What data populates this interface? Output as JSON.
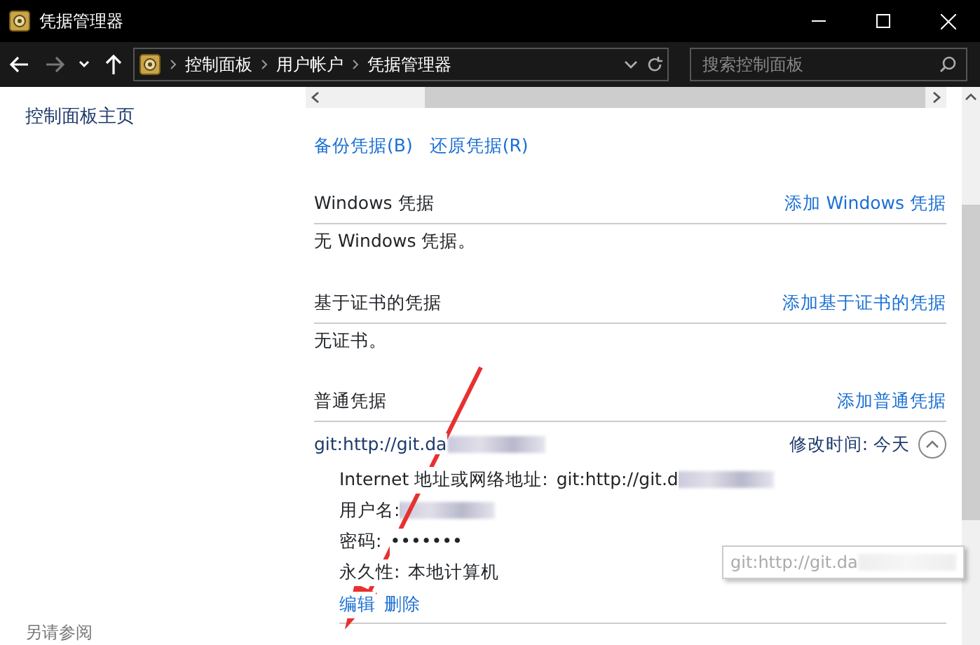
{
  "window": {
    "title": "凭据管理器"
  },
  "address_bar": {
    "breadcrumbs": [
      "控制面板",
      "用户帐户",
      "凭据管理器"
    ]
  },
  "search": {
    "placeholder": "搜索控制面板"
  },
  "sidebar": {
    "home_link": "控制面板主页",
    "see_also": "另请参阅"
  },
  "actions": [
    "备份凭据(B)",
    "还原凭据(R)"
  ],
  "sections": [
    {
      "title": "Windows 凭据",
      "add_link": "添加 Windows 凭据",
      "empty_text": "无 Windows 凭据。"
    },
    {
      "title": "基于证书的凭据",
      "add_link": "添加基于证书的凭据",
      "empty_text": "无证书。"
    },
    {
      "title": "普通凭据",
      "add_link": "添加普通凭据",
      "credentials": [
        {
          "name": "git:http://git.da",
          "redacted": true,
          "modified_label": "修改时间:",
          "modified": "今天",
          "expanded": true,
          "details": [
            {
              "label": "Internet 地址或网络地址:",
              "value": "git:http://git.d",
              "redacted": true
            },
            {
              "label": "用户名:",
              "redacted": true
            },
            {
              "label": "密码:",
              "value": "•••••••",
              "redacted": false
            },
            {
              "label": "永久性:",
              "value": "本地计算机",
              "redacted": false
            }
          ],
          "actions": [
            "编辑",
            "删除"
          ]
        }
      ]
    }
  ],
  "tooltip": {
    "text": "git:http://git.da",
    "redacted": true
  }
}
